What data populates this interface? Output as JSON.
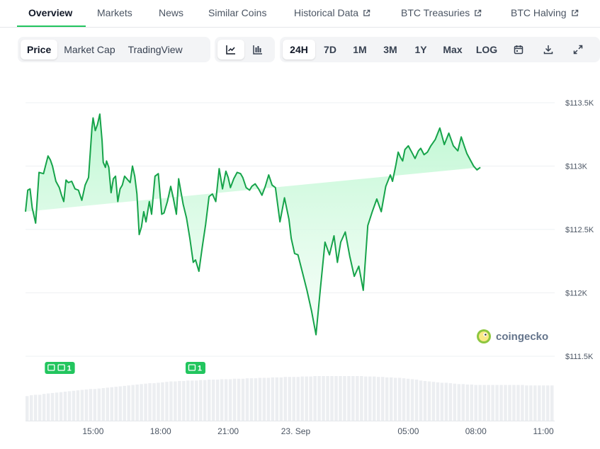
{
  "tabs": [
    {
      "label": "Overview",
      "active": true,
      "external": false
    },
    {
      "label": "Markets",
      "active": false,
      "external": false
    },
    {
      "label": "News",
      "active": false,
      "external": false
    },
    {
      "label": "Similar Coins",
      "active": false,
      "external": false
    },
    {
      "label": "Historical Data",
      "active": false,
      "external": true
    },
    {
      "label": "BTC Treasuries",
      "active": false,
      "external": true
    },
    {
      "label": "BTC Halving",
      "active": false,
      "external": true
    }
  ],
  "metric_toggle": [
    "Price",
    "Market Cap",
    "TradingView"
  ],
  "metric_selected": "Price",
  "chart_style_icons": [
    "line-chart-icon",
    "candlestick-chart-icon"
  ],
  "range_buttons": [
    "24H",
    "7D",
    "1M",
    "3M",
    "1Y",
    "Max",
    "LOG"
  ],
  "range_selected": "24H",
  "tool_icons": [
    "calendar-icon",
    "download-icon",
    "expand-icon"
  ],
  "watermark": "coingecko",
  "colors": {
    "line": "#16a34a",
    "fill_top": "#bbf7d0",
    "accent": "#22c55e",
    "volume": "#e5e7eb",
    "badge": "#22c55e"
  },
  "news_badges": [
    {
      "label": "1",
      "time": 13.3
    },
    {
      "label": "1",
      "time": 13.75
    },
    {
      "label": "1",
      "time": 19.55
    }
  ],
  "chart_data": {
    "type": "area",
    "x_unit": "hours since 12:00 Sep 22",
    "ylim": [
      111500,
      113500
    ],
    "yticks": [
      {
        "v": 113500,
        "label": "$113.5K"
      },
      {
        "v": 113000,
        "label": "$113K"
      },
      {
        "v": 112500,
        "label": "$112.5K"
      },
      {
        "v": 112000,
        "label": "$112K"
      },
      {
        "v": 111500,
        "label": "$111.5K"
      }
    ],
    "xlim": [
      12.0,
      35.5
    ],
    "xticks": [
      {
        "v": 15,
        "label": "15:00"
      },
      {
        "v": 18,
        "label": "18:00"
      },
      {
        "v": 21,
        "label": "21:00"
      },
      {
        "v": 24,
        "label": "23. Sep"
      },
      {
        "v": 29,
        "label": "05:00"
      },
      {
        "v": 32,
        "label": "08:00"
      },
      {
        "v": 35,
        "label": "11:00"
      }
    ],
    "grid": true,
    "x": [
      12.0,
      12.1,
      12.2,
      12.3,
      12.45,
      12.6,
      12.8,
      13.0,
      13.1,
      13.2,
      13.35,
      13.5,
      13.6,
      13.7,
      13.8,
      13.9,
      14.05,
      14.2,
      14.35,
      14.5,
      14.65,
      14.8,
      14.95,
      15.0,
      15.1,
      15.2,
      15.3,
      15.4,
      15.45,
      15.55,
      15.6,
      15.7,
      15.8,
      15.9,
      16.0,
      16.1,
      16.2,
      16.3,
      16.4,
      16.5,
      16.65,
      16.75,
      16.85,
      16.95,
      17.05,
      17.15,
      17.25,
      17.35,
      17.5,
      17.6,
      17.75,
      17.9,
      18.05,
      18.15,
      18.3,
      18.45,
      18.55,
      18.7,
      18.8,
      19.0,
      19.15,
      19.3,
      19.45,
      19.55,
      19.7,
      19.85,
      20.0,
      20.15,
      20.3,
      20.45,
      20.6,
      20.75,
      20.9,
      21.0,
      21.1,
      21.25,
      21.4,
      21.55,
      21.65,
      21.8,
      21.95,
      22.05,
      22.2,
      22.35,
      22.5,
      22.65,
      22.8,
      22.95,
      23.1,
      23.3,
      23.5,
      23.7,
      23.8,
      23.95,
      24.1,
      24.3,
      24.5,
      24.7,
      24.9,
      25.1,
      25.3,
      25.5,
      25.7,
      25.85,
      26.0,
      26.2,
      26.4,
      26.6,
      26.8,
      27.0,
      27.2,
      27.4,
      27.6,
      27.8,
      28.0,
      28.2,
      28.3,
      28.45,
      28.55,
      28.65,
      28.75,
      28.85,
      29.0,
      29.15,
      29.3,
      29.45,
      29.55,
      29.7,
      29.85,
      30.0,
      30.2,
      30.4,
      30.6,
      30.8,
      31.0,
      31.2,
      31.35,
      31.5,
      31.6,
      31.75,
      31.9,
      32.05,
      32.2,
      32.35,
      32.5,
      32.65,
      32.8,
      32.95,
      33.1,
      33.25,
      33.35,
      33.5,
      33.65,
      33.8,
      33.95,
      34.1,
      34.25,
      34.4,
      34.55,
      34.7,
      34.85,
      34.95,
      35.1,
      35.25,
      35.4
    ],
    "y": [
      112640,
      112810,
      112820,
      112670,
      112550,
      112950,
      112940,
      113080,
      113050,
      113000,
      112880,
      112830,
      112770,
      112720,
      112890,
      112870,
      112880,
      112820,
      112810,
      112730,
      112850,
      112910,
      113300,
      113380,
      113280,
      113330,
      113410,
      113200,
      113030,
      112990,
      113040,
      112990,
      112790,
      112900,
      112920,
      112720,
      112820,
      112850,
      112920,
      112900,
      112870,
      113000,
      112920,
      112780,
      112460,
      112520,
      112640,
      112560,
      112720,
      112620,
      112920,
      112940,
      112620,
      112630,
      112720,
      112840,
      112760,
      112620,
      112900,
      112700,
      112590,
      112430,
      112240,
      112260,
      112170,
      112360,
      112540,
      112760,
      112780,
      112720,
      112980,
      112820,
      112960,
      112910,
      112830,
      112900,
      112950,
      112940,
      112910,
      112830,
      112810,
      112840,
      112860,
      112820,
      112770,
      112840,
      112930,
      112850,
      112830,
      112560,
      112750,
      112580,
      112430,
      112310,
      112300,
      112160,
      112020,
      111860,
      111670,
      112040,
      112400,
      112300,
      112450,
      112240,
      112400,
      112480,
      112290,
      112130,
      112210,
      112020,
      112530,
      112640,
      112740,
      112640,
      112840,
      112930,
      112880,
      113010,
      113110,
      113070,
      113040,
      113130,
      113160,
      113110,
      113060,
      113120,
      113140,
      113090,
      113110,
      113160,
      113210,
      113300,
      113170,
      113260,
      113160,
      113120,
      113230,
      113150,
      113100,
      113050,
      113000,
      112970,
      112990
    ],
    "volume": [
      0.55,
      0.57,
      0.58,
      0.58,
      0.6,
      0.61,
      0.62,
      0.63,
      0.64,
      0.65,
      0.66,
      0.67,
      0.68,
      0.69,
      0.7,
      0.71,
      0.71,
      0.72,
      0.73,
      0.74,
      0.75,
      0.76,
      0.77,
      0.78,
      0.79,
      0.8,
      0.81,
      0.82,
      0.83,
      0.84,
      0.84,
      0.85,
      0.86,
      0.87,
      0.88,
      0.88,
      0.89,
      0.89,
      0.9,
      0.9,
      0.9,
      0.91,
      0.91,
      0.92,
      0.92,
      0.92,
      0.93,
      0.93,
      0.93,
      0.94,
      0.94,
      0.94,
      0.95,
      0.95,
      0.95,
      0.96,
      0.96,
      0.96,
      0.97,
      0.97,
      0.97,
      0.98,
      0.98,
      0.98,
      0.98,
      0.99,
      0.99,
      0.99,
      1.0,
      1.0,
      1.0,
      1.0,
      1.0,
      1.0,
      1.0,
      1.0,
      1.0,
      1.0,
      1.0,
      1.0,
      0.99,
      0.99,
      0.99,
      0.98,
      0.98,
      0.97,
      0.97,
      0.96,
      0.96,
      0.95,
      0.94,
      0.93,
      0.92,
      0.9,
      0.89,
      0.88,
      0.87,
      0.86,
      0.85,
      0.85,
      0.84,
      0.83,
      0.82,
      0.82,
      0.81,
      0.81,
      0.8,
      0.8,
      0.8,
      0.8,
      0.8,
      0.8,
      0.8,
      0.8,
      0.8,
      0.8,
      0.8,
      0.8,
      0.79,
      0.79,
      0.79,
      0.79,
      0.79,
      0.79,
      0.79
    ]
  }
}
